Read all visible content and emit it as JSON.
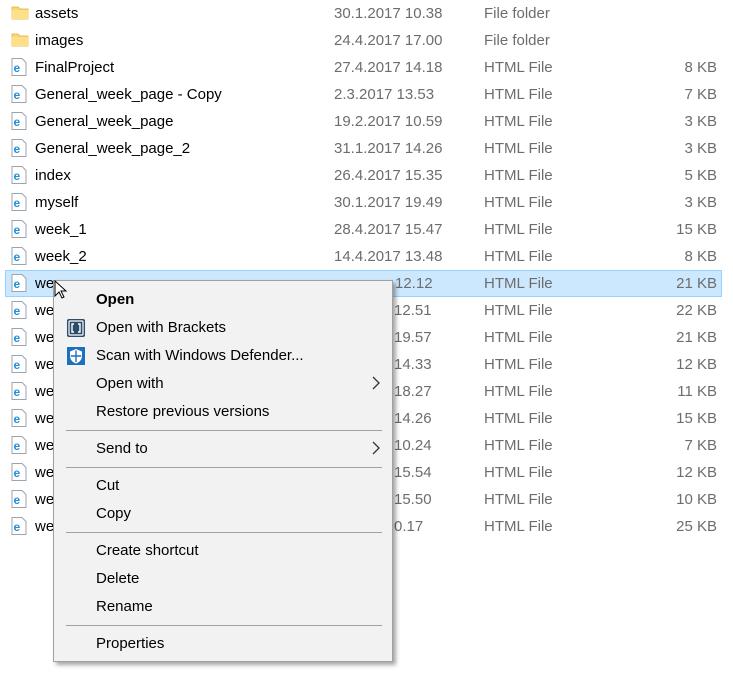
{
  "files": [
    {
      "name": "assets",
      "date": "30.1.2017 10.38",
      "type": "File folder",
      "size": "",
      "icon": "folder-icon"
    },
    {
      "name": "images",
      "date": "24.4.2017 17.00",
      "type": "File folder",
      "size": "",
      "icon": "folder-icon"
    },
    {
      "name": "FinalProject",
      "date": "27.4.2017 14.18",
      "type": "HTML File",
      "size": "8 KB",
      "icon": "edge-html-icon"
    },
    {
      "name": "General_week_page - Copy",
      "date": "2.3.2017 13.53",
      "type": "HTML File",
      "size": "7 KB",
      "icon": "edge-html-icon"
    },
    {
      "name": "General_week_page",
      "date": "19.2.2017 10.59",
      "type": "HTML File",
      "size": "3 KB",
      "icon": "edge-html-icon"
    },
    {
      "name": "General_week_page_2",
      "date": "31.1.2017 14.26",
      "type": "HTML File",
      "size": "3 KB",
      "icon": "edge-html-icon"
    },
    {
      "name": "index",
      "date": "26.4.2017 15.35",
      "type": "HTML File",
      "size": "5 KB",
      "icon": "edge-html-icon"
    },
    {
      "name": "myself",
      "date": "30.1.2017 19.49",
      "type": "HTML File",
      "size": "3 KB",
      "icon": "edge-html-icon"
    },
    {
      "name": "week_1",
      "date": "28.4.2017 15.47",
      "type": "HTML File",
      "size": "15 KB",
      "icon": "edge-html-icon"
    },
    {
      "name": "week_2",
      "date": "14.4.2017 13.48",
      "type": "HTML File",
      "size": "8 KB",
      "icon": "edge-html-icon"
    },
    {
      "name": "we",
      "date": "12.12",
      "type": "HTML File",
      "size": "21 KB",
      "icon": "edge-html-icon",
      "selected": true
    },
    {
      "name": "we",
      "date": "12.51",
      "type": "HTML File",
      "size": "22 KB",
      "icon": "edge-html-icon"
    },
    {
      "name": "we",
      "date": "19.57",
      "type": "HTML File",
      "size": "21 KB",
      "icon": "edge-html-icon"
    },
    {
      "name": "we",
      "date": "14.33",
      "type": "HTML File",
      "size": "12 KB",
      "icon": "edge-html-icon"
    },
    {
      "name": "we",
      "date": "18.27",
      "type": "HTML File",
      "size": "11 KB",
      "icon": "edge-html-icon"
    },
    {
      "name": "we",
      "date": "14.26",
      "type": "HTML File",
      "size": "15 KB",
      "icon": "edge-html-icon"
    },
    {
      "name": "we",
      "date": "10.24",
      "type": "HTML File",
      "size": "7 KB",
      "icon": "edge-html-icon"
    },
    {
      "name": "we",
      "date": "15.54",
      "type": "HTML File",
      "size": "12 KB",
      "icon": "edge-html-icon"
    },
    {
      "name": "we",
      "date": "15.50",
      "type": "HTML File",
      "size": "10 KB",
      "icon": "edge-html-icon"
    },
    {
      "name": "we",
      "date": "0.17",
      "type": "HTML File",
      "size": "25 KB",
      "icon": "edge-html-icon"
    }
  ],
  "context_menu": {
    "items": [
      {
        "label": "Open",
        "bold": true
      },
      {
        "label": "Open with Brackets",
        "icon": "brackets-icon"
      },
      {
        "label": "Scan with Windows Defender...",
        "icon": "windows-defender-icon"
      },
      {
        "label": "Open with",
        "submenu": true
      },
      {
        "label": "Restore previous versions"
      },
      {
        "separator": true
      },
      {
        "label": "Send to",
        "submenu": true
      },
      {
        "separator": true
      },
      {
        "label": "Cut"
      },
      {
        "label": "Copy"
      },
      {
        "separator": true
      },
      {
        "label": "Create shortcut"
      },
      {
        "label": "Delete"
      },
      {
        "label": "Rename"
      },
      {
        "separator": true
      },
      {
        "label": "Properties"
      }
    ]
  },
  "colors": {
    "selection_bg": "#cce8ff",
    "selection_border": "#99d1ff",
    "menu_bg": "#f2f2f2",
    "secondary_text": "#6d6d6d",
    "edge_blue": "#1e90dc",
    "folder_yellow": "#f8d775"
  }
}
